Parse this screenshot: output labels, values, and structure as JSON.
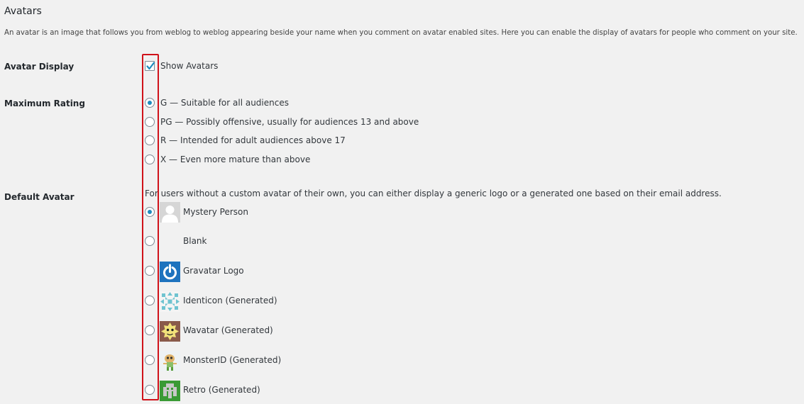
{
  "section": {
    "title": "Avatars",
    "description": "An avatar is an image that follows you from weblog to weblog appearing beside your name when you comment on avatar enabled sites. Here you can enable the display of avatars for people who comment on your site."
  },
  "avatar_display": {
    "label": "Avatar Display",
    "checkbox_label": "Show Avatars",
    "checked": true
  },
  "maximum_rating": {
    "label": "Maximum Rating",
    "options": [
      {
        "label": "G — Suitable for all audiences",
        "selected": true
      },
      {
        "label": "PG — Possibly offensive, usually for audiences 13 and above",
        "selected": false
      },
      {
        "label": "R — Intended for adult audiences above 17",
        "selected": false
      },
      {
        "label": "X — Even more mature than above",
        "selected": false
      }
    ]
  },
  "default_avatar": {
    "label": "Default Avatar",
    "description": "For users without a custom avatar of their own, you can either display a generic logo or a generated one based on their email address.",
    "options": [
      {
        "label": "Mystery Person",
        "icon": "mystery-person-icon",
        "selected": true
      },
      {
        "label": "Blank",
        "icon": "blank-icon",
        "selected": false
      },
      {
        "label": "Gravatar Logo",
        "icon": "gravatar-logo-icon",
        "selected": false
      },
      {
        "label": "Identicon (Generated)",
        "icon": "identicon-icon",
        "selected": false
      },
      {
        "label": "Wavatar (Generated)",
        "icon": "wavatar-icon",
        "selected": false
      },
      {
        "label": "MonsterID (Generated)",
        "icon": "monsterid-icon",
        "selected": false
      },
      {
        "label": "Retro (Generated)",
        "icon": "retro-icon",
        "selected": false
      }
    ]
  },
  "colors": {
    "accent": "#1e8cbe",
    "highlight": "#d0121a",
    "background": "#f1f1f1"
  }
}
